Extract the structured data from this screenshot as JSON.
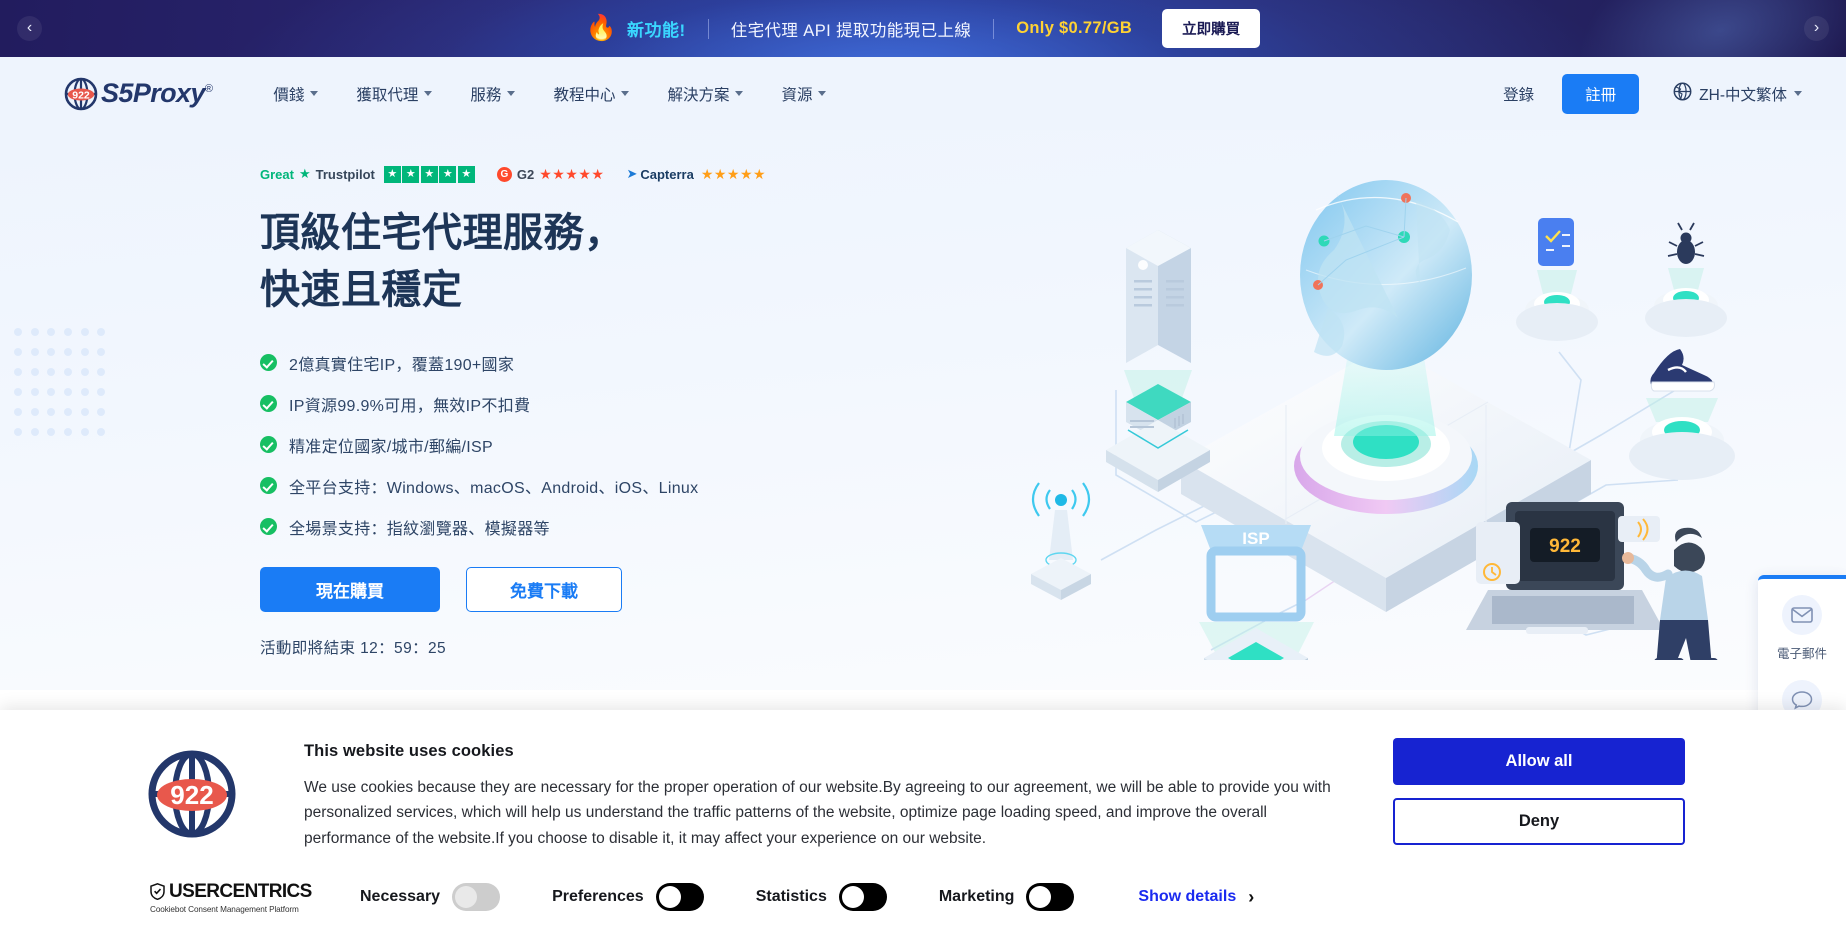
{
  "promo": {
    "prev_icon": "chevron-left-icon",
    "next_icon": "chevron-right-icon",
    "fire_icon": "🔥",
    "new_label": "新功能!",
    "message": "住宅代理 API 提取功能現已上線",
    "price": "Only $0.77/GB",
    "cta": "立即購買"
  },
  "header": {
    "logo_text": "S5Proxy",
    "logo_badge": "922",
    "logo_reg": "®",
    "nav": [
      {
        "label": "價錢",
        "has_caret": true
      },
      {
        "label": "獲取代理",
        "has_caret": true
      },
      {
        "label": "服務",
        "has_caret": true
      },
      {
        "label": "教程中心",
        "has_caret": true
      },
      {
        "label": "解決方案",
        "has_caret": true
      },
      {
        "label": "資源",
        "has_caret": true
      }
    ],
    "login": "登錄",
    "signup": "註冊",
    "language": "ZH-中文繁体"
  },
  "hero": {
    "badges": {
      "trustpilot_rating_word": "Great",
      "trustpilot_name": "Trustpilot",
      "trustpilot_stars": 5,
      "g2_name": "G2",
      "g2_stars": 5,
      "capterra_name": "Capterra",
      "capterra_stars": 5
    },
    "title_line1": "頂級住宅代理服務，",
    "title_line2": "快速且穩定",
    "features": [
      "2億真實住宅IP，覆蓋190+國家",
      "IP資源99.9%可用，無效IP不扣費",
      "精准定位國家/城市/郵編/ISP",
      "全平台支持：Windows、macOS、Android、iOS、Linux",
      "全場景支持：指紋瀏覽器、模擬器等"
    ],
    "buy_now": "現在購買",
    "free_download": "免費下載",
    "timer_text": "活動即將結束 12：59：25",
    "illustration": {
      "isp_label": "ISP",
      "laptop_label": "922"
    }
  },
  "side_widget": {
    "items": [
      {
        "icon": "email-icon",
        "label": "電子郵件"
      }
    ]
  },
  "cookie": {
    "logo_badge": "922",
    "heading": "This website uses cookies",
    "paragraph": "We use cookies because they are necessary for the proper operation of our website.By agreeing to our agreement, we will be able to provide you with personalized services, which will help us understand the traffic patterns of the website, optimize page loading speed, and improve the overall performance of the website.If you choose to disable it, it may affect your experience on our website.",
    "allow_all": "Allow all",
    "deny": "Deny",
    "provider_name": "USERCENTRICS",
    "provider_sub": "Cookiebot Consent Management Platform",
    "toggles": [
      {
        "label": "Necessary",
        "state": "disabled"
      },
      {
        "label": "Preferences",
        "state": "off"
      },
      {
        "label": "Statistics",
        "state": "off"
      },
      {
        "label": "Marketing",
        "state": "off"
      }
    ],
    "show_details": "Show details",
    "show_details_icon": "chevron-right-icon"
  },
  "colors": {
    "brand_blue": "#1a7cf5",
    "promo_dark": "#28246d",
    "promo_cyan": "#3ad6ff",
    "promo_yellow": "#ffd233",
    "cookie_blue": "#1723d1",
    "check_green": "#17bf63",
    "trustpilot_green": "#00b67a",
    "g2_red": "#ff492c",
    "capterra_orange": "#ff9e18",
    "logo_navy": "#23376b",
    "logo_red": "#e8584c"
  }
}
